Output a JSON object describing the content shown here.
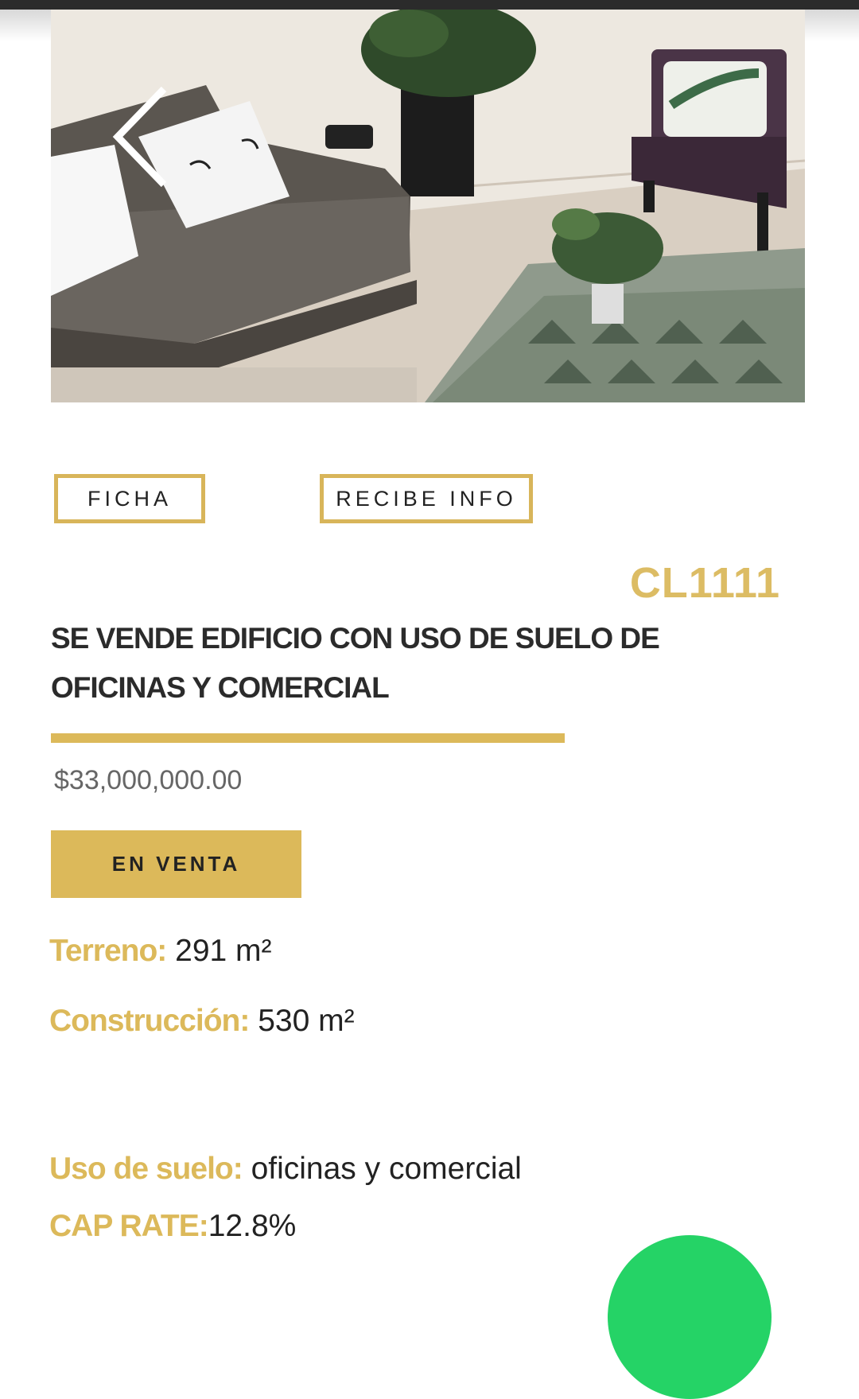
{
  "gallery": {
    "image": "office-lounge-photo",
    "prev_icon": "chevron-left-icon"
  },
  "actions": {
    "ficha_label": "FICHA",
    "recibe_label": "RECIBE INFO"
  },
  "property": {
    "code": "CL1111",
    "title": "SE VENDE EDIFICIO CON USO DE SUELO DE OFICINAS Y COMERCIAL",
    "price": "$33,000,000.00",
    "status": "EN VENTA",
    "specs": [
      {
        "label": "Terreno:",
        "value": "291 m²"
      },
      {
        "label": "Construcción:",
        "value": "530 m²"
      },
      {
        "label": "Uso de suelo:",
        "value": "oficinas y comercial"
      },
      {
        "label": "CAP RATE:",
        "value": "12.8%"
      }
    ]
  },
  "floating": {
    "icon": "whatsapp-icon"
  },
  "colors": {
    "accent": "#dcb95a",
    "text": "#222222",
    "whatsapp": "#25d366"
  }
}
